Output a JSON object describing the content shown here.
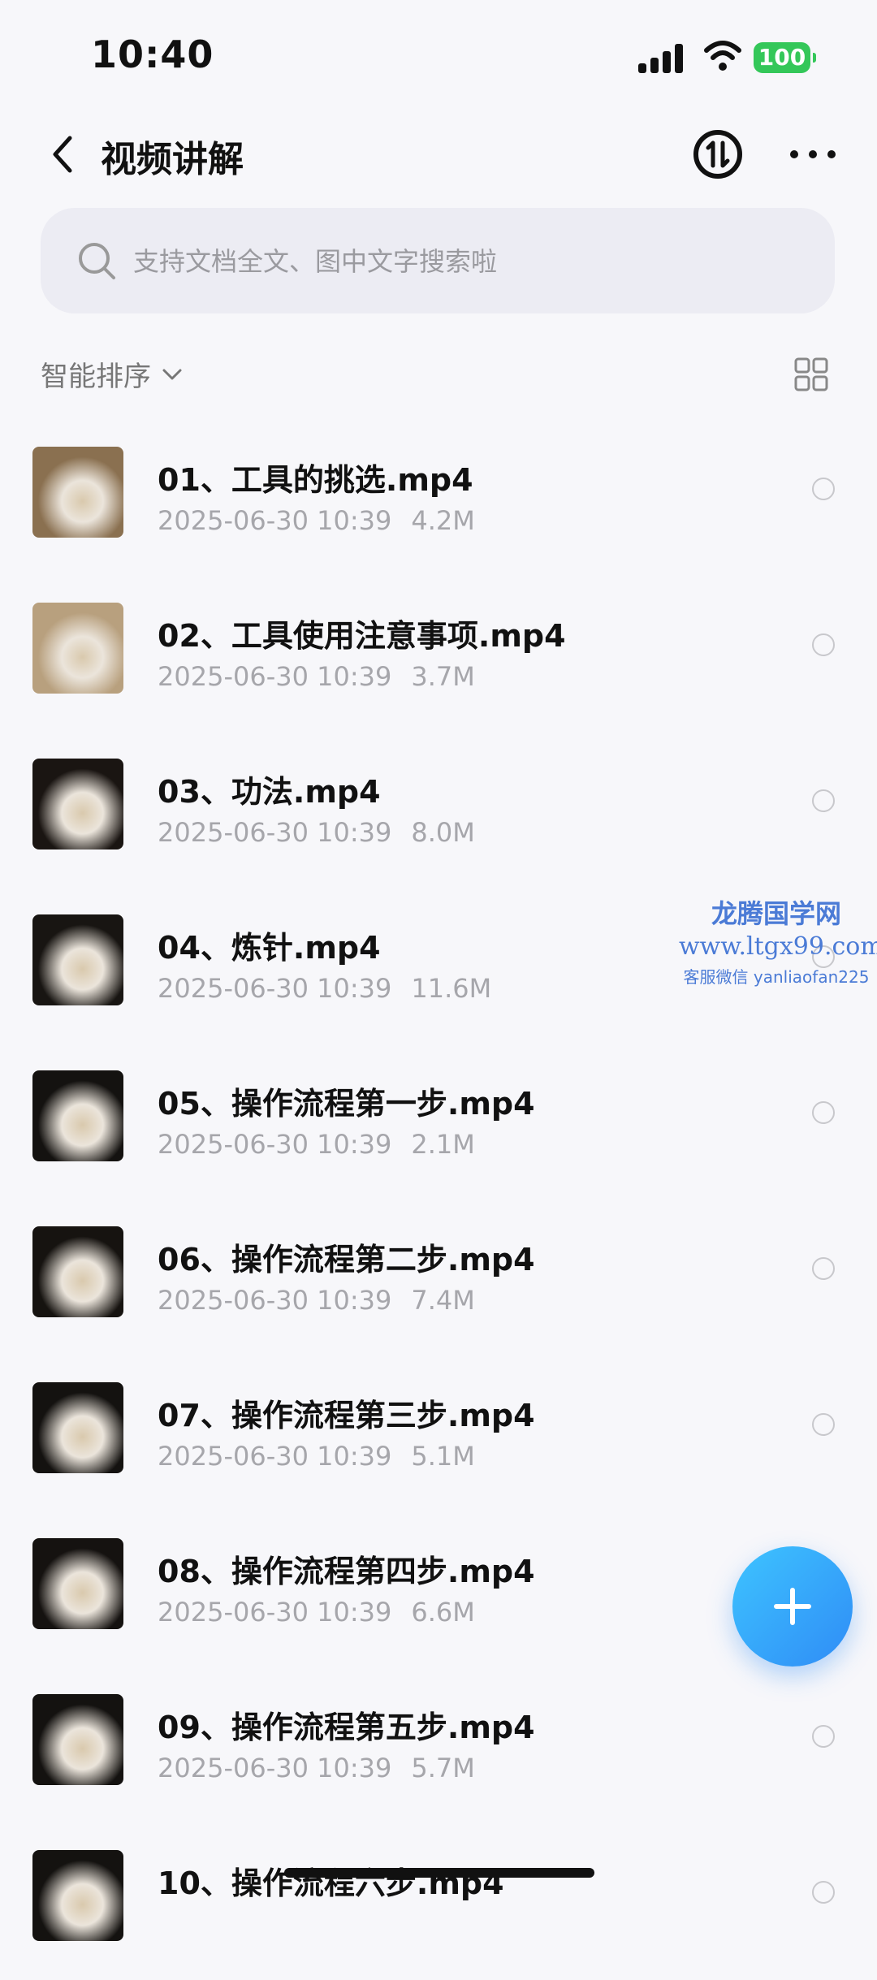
{
  "status_bar": {
    "time": "10:40",
    "battery": "100"
  },
  "nav": {
    "title": "视频讲解",
    "back_icon": "chevron-left-icon",
    "cloud_icon": "cloud-sync-icon",
    "more_icon": "more-dots-icon"
  },
  "search": {
    "placeholder": "支持文档全文、图中文字搜索啦"
  },
  "sort": {
    "label": "智能排序"
  },
  "files": [
    {
      "name": "01、工具的挑选.mp4",
      "date": "2025-06-30 10:39",
      "size": "4.2M",
      "thumb_bg": "#8a7050"
    },
    {
      "name": "02、工具使用注意事项.mp4",
      "date": "2025-06-30 10:39",
      "size": "3.7M",
      "thumb_bg": "#b8a07e"
    },
    {
      "name": "03、功法.mp4",
      "date": "2025-06-30 10:39",
      "size": "8.0M",
      "thumb_bg": "#1a1512"
    },
    {
      "name": "04、炼针.mp4",
      "date": "2025-06-30 10:39",
      "size": "11.6M",
      "thumb_bg": "#181512"
    },
    {
      "name": "05、操作流程第一步.mp4",
      "date": "2025-06-30 10:39",
      "size": "2.1M",
      "thumb_bg": "#141210"
    },
    {
      "name": "06、操作流程第二步.mp4",
      "date": "2025-06-30 10:39",
      "size": "7.4M",
      "thumb_bg": "#161310"
    },
    {
      "name": "07、操作流程第三步.mp4",
      "date": "2025-06-30 10:39",
      "size": "5.1M",
      "thumb_bg": "#141210"
    },
    {
      "name": "08、操作流程第四步.mp4",
      "date": "2025-06-30 10:39",
      "size": "6.6M",
      "thumb_bg": "#151210"
    },
    {
      "name": "09、操作流程第五步.mp4",
      "date": "2025-06-30 10:39",
      "size": "5.7M",
      "thumb_bg": "#141210"
    },
    {
      "name": "10、操作流程六步.mp4",
      "date": "",
      "size": "",
      "thumb_bg": "#141210"
    }
  ],
  "watermark": {
    "title": "龙腾国学网",
    "url": "www.ltgx99.com",
    "contact": "客服微信 yanliaofan225"
  },
  "fab": {
    "icon": "plus-icon",
    "color": "#2f8cf6"
  }
}
